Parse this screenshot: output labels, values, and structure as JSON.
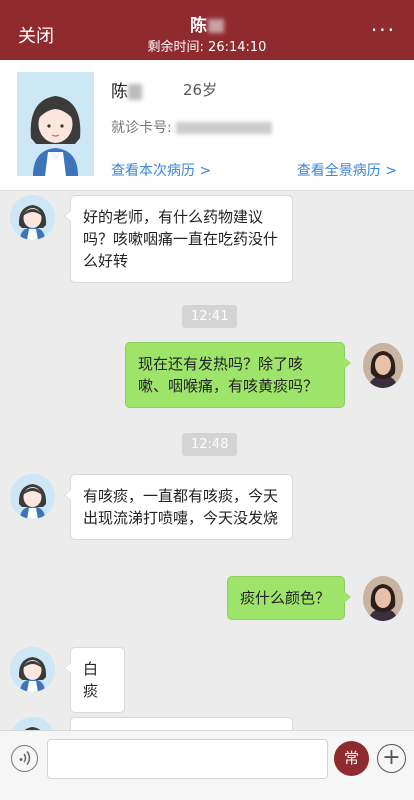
{
  "header": {
    "close_label": "关闭",
    "patient_name_visible": "陈",
    "timer_label": "剩余时间: 26:14:10",
    "more_label": "···"
  },
  "patient": {
    "name_visible": "陈",
    "age": "26岁",
    "card_label": "就诊卡号: ",
    "link_current_record": "查看本次病历 >",
    "link_full_record": "查看全景病历 >"
  },
  "messages": [
    {
      "from": "patient",
      "text": "好的老师，有什么药物建议吗？咳嗽咽痛一直在吃药没什么好转"
    },
    {
      "type": "time",
      "text": "12:41"
    },
    {
      "from": "doctor",
      "text": "现在还有发热吗？除了咳嗽、咽喉痛，有咳黄痰吗？"
    },
    {
      "type": "time",
      "text": "12:48"
    },
    {
      "from": "patient",
      "text": "有咳痰，一直都有咳痰，今天出现流涕打喷嚏，今天没发烧"
    },
    {
      "from": "doctor",
      "text": "痰什么颜色？"
    },
    {
      "from": "patient",
      "text": "白痰"
    }
  ],
  "inputbar": {
    "voice_icon": "voice-icon",
    "common_phrases_label": "常",
    "plus_label": "+"
  },
  "colors": {
    "brand": "#8f2a2e",
    "doctor_bubble": "#9ee46b",
    "link": "#3b86d6"
  }
}
